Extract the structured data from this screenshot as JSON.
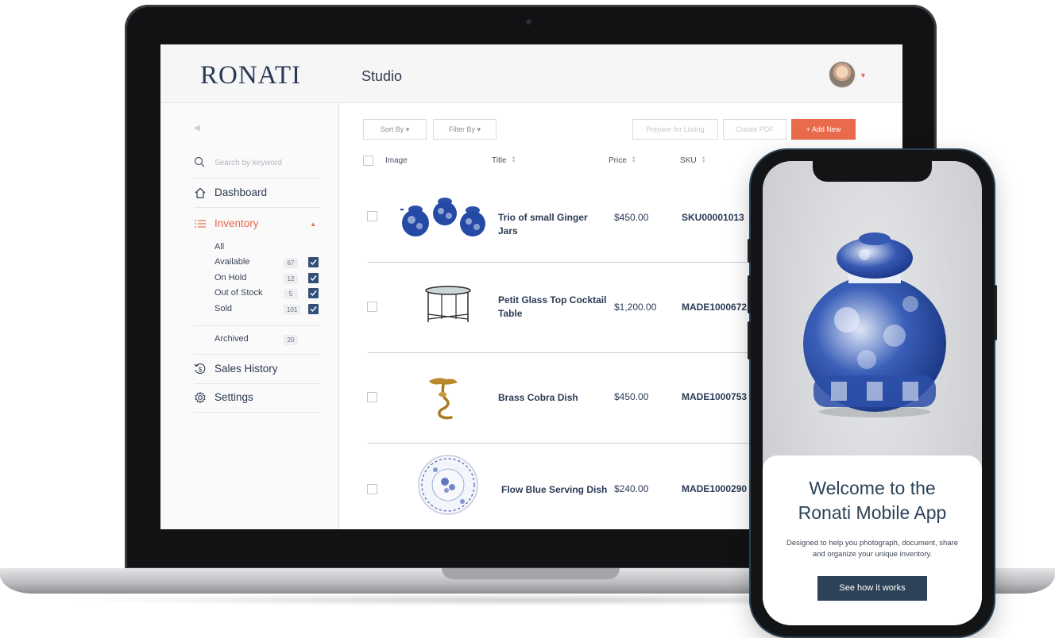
{
  "app": {
    "logo": "RONATI",
    "page_title": "Studio"
  },
  "sidebar": {
    "search_placeholder": "Search by keyword",
    "items": [
      {
        "label": "Dashboard",
        "icon": "home-icon"
      },
      {
        "label": "Inventory",
        "icon": "list-icon",
        "active": true
      },
      {
        "label": "Sales History",
        "icon": "dollar-history-icon"
      },
      {
        "label": "Settings",
        "icon": "gear-icon"
      }
    ],
    "inventory_filters": [
      {
        "label": "All"
      },
      {
        "label": "Available",
        "count": "67",
        "checked": true
      },
      {
        "label": "On Hold",
        "count": "12",
        "checked": true
      },
      {
        "label": "Out of Stock",
        "count": "5",
        "checked": true
      },
      {
        "label": "Sold",
        "count": "101",
        "checked": true
      }
    ],
    "archived": {
      "label": "Archived",
      "count": "20"
    }
  },
  "toolbar": {
    "sort_by": "Sort By",
    "filter_by": "Filter By",
    "prepare_listing": "Prepare for Listing",
    "create_pdf": "Create PDF",
    "add_new": "+ Add New"
  },
  "table": {
    "headers": {
      "image": "Image",
      "title": "Title",
      "price": "Price",
      "sku": "SKU"
    },
    "rows": [
      {
        "title": "Trio of small Ginger Jars",
        "price": "$450.00",
        "sku": "SKU00001013",
        "image": "ginger-jars-image"
      },
      {
        "title": "Petit Glass Top Cocktail Table",
        "price": "$1,200.00",
        "sku": "MADE1000672",
        "image": "cocktail-table-image"
      },
      {
        "title": "Brass Cobra Dish",
        "price": "$450.00",
        "sku": "MADE1000753",
        "image": "cobra-dish-image"
      },
      {
        "title": "Flow Blue Serving Dish",
        "price": "$240.00",
        "sku": "MADE1000290",
        "image": "serving-dish-image"
      }
    ]
  },
  "mobile": {
    "welcome_line1": "Welcome to the",
    "welcome_line2": "Ronati Mobile App",
    "subtitle": "Designed to help you photograph, document, share and organize your unique inventory.",
    "cta": "See how it works"
  },
  "colors": {
    "brand_navy": "#2a3a55",
    "accent_orange": "#ea6a4c",
    "checkbox_blue": "#34507a",
    "cta_navy": "#2d4258"
  }
}
